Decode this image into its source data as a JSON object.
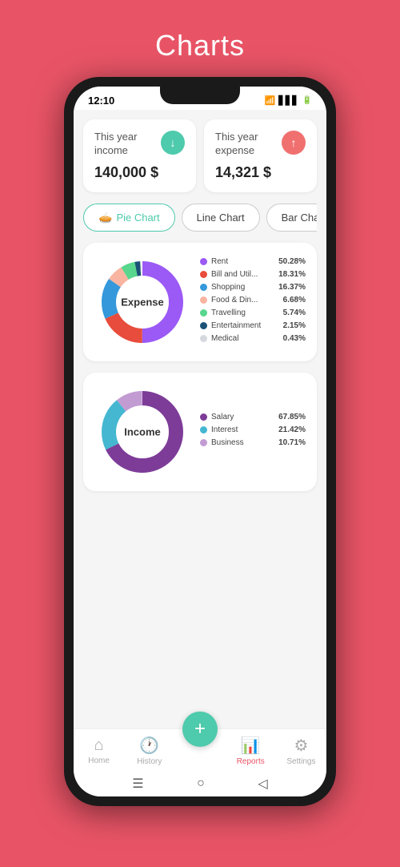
{
  "page": {
    "title": "Charts",
    "background": "#E85466"
  },
  "status_bar": {
    "time": "12:10",
    "icons": [
      "●",
      "WiFi",
      "LTE",
      "🔋"
    ]
  },
  "summary_cards": [
    {
      "label": "This year income",
      "amount": "140,000 $",
      "icon": "↓",
      "icon_color": "green"
    },
    {
      "label": "This year expense",
      "amount": "14,321 $",
      "icon": "↑",
      "icon_color": "red"
    }
  ],
  "tabs": [
    {
      "label": "Pie Chart",
      "icon": "🥧",
      "active": true
    },
    {
      "label": "Line Chart",
      "icon": "",
      "active": false
    },
    {
      "label": "Bar Chart",
      "icon": "",
      "active": false
    }
  ],
  "expense_chart": {
    "title": "Expense",
    "segments": [
      {
        "label": "Rent",
        "pct": 50.28,
        "color": "#9B59F5",
        "degrees": 181
      },
      {
        "label": "Bill and Util...",
        "pct": 18.31,
        "color": "#E74C3C",
        "degrees": 66
      },
      {
        "label": "Shopping",
        "pct": 16.37,
        "color": "#3498DB",
        "degrees": 59
      },
      {
        "label": "Food & Din...",
        "pct": 6.68,
        "color": "#F8B4A0",
        "degrees": 24
      },
      {
        "label": "Travelling",
        "pct": 5.74,
        "color": "#58D68D",
        "degrees": 21
      },
      {
        "label": "Entertainment",
        "pct": 2.15,
        "color": "#1A5276",
        "degrees": 8
      },
      {
        "label": "Medical",
        "pct": 0.43,
        "color": "#D5D8DC",
        "degrees": 2
      }
    ]
  },
  "income_chart": {
    "title": "Income",
    "segments": [
      {
        "label": "Salary",
        "pct": 67.85,
        "color": "#7D3C98",
        "degrees": 244
      },
      {
        "label": "Interest",
        "pct": 21.42,
        "color": "#45B7D1",
        "degrees": 77
      },
      {
        "label": "Business",
        "pct": 10.71,
        "color": "#C39BD3",
        "degrees": 39
      }
    ]
  },
  "bottom_nav": [
    {
      "label": "Home",
      "icon": "⌂",
      "active": false
    },
    {
      "label": "History",
      "icon": "🕐",
      "active": false
    },
    {
      "label": "Reports",
      "icon": "📊",
      "active": true
    },
    {
      "label": "Settings",
      "icon": "⚙",
      "active": false
    }
  ],
  "fab": {
    "label": "+"
  }
}
